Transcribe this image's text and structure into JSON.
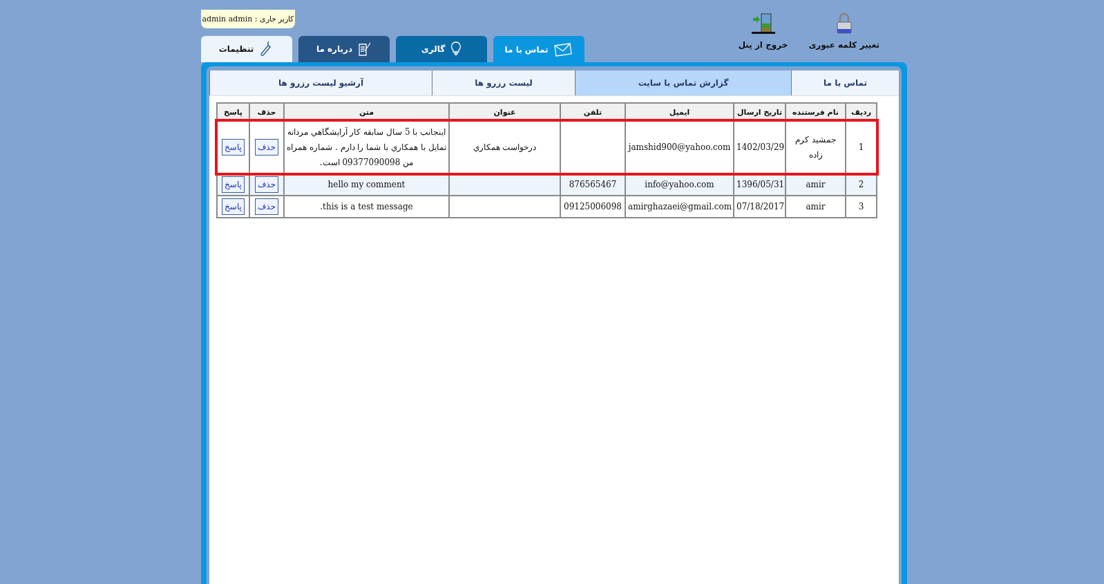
{
  "current_user": {
    "label": "کاربر جاری :",
    "name": "admin admin"
  },
  "main_tabs": [
    {
      "label": "تماس با ما",
      "selected": true,
      "color": "#0b97e0"
    },
    {
      "label": "گالری",
      "selected": false,
      "color": "#0a6aa6"
    },
    {
      "label": "درباره ما",
      "selected": false,
      "color": "#265587"
    },
    {
      "label": "تنظیمات",
      "selected": false,
      "color": "#eef4fc"
    }
  ],
  "toolbar": [
    {
      "label": "تغییر کلمه عبوری"
    },
    {
      "label": "خروج از پنل"
    }
  ],
  "sub_tabs": [
    {
      "label": "تماس با ما",
      "selected": false
    },
    {
      "label": "گزارش تماس با سایت",
      "selected": true
    },
    {
      "label": "لیست رزرو ها",
      "selected": false
    },
    {
      "label": "آرشیو لیست رزرو ها",
      "selected": false
    }
  ],
  "table": {
    "columns": [
      "ردیف",
      "نام فرستنده",
      "تاریخ ارسال",
      "ایمیل",
      "تلفن",
      "عنوان",
      "متن",
      "حذف",
      "پاسخ"
    ],
    "rows": [
      {
        "cells": [
          "1",
          "جمشید کرم زاده",
          "1402/03/29",
          "jamshid900@yahoo.com",
          "",
          "درخواست همکاري",
          "اینجانب با 5 سال سابقه کار آرايشگاهي مردانه تمایل با همکاري با شما را دارم . شماره همراه من 09377090098 است."
        ],
        "delete": "حذف",
        "reply": "پاسخ",
        "highlighted": true,
        "shaded": false
      },
      {
        "cells": [
          "2",
          "amir",
          "1396/05/31",
          "info@yahoo.com",
          "876565467",
          "",
          "hello my comment"
        ],
        "delete": "حذف",
        "reply": "پاسخ",
        "highlighted": false,
        "shaded": true
      },
      {
        "cells": [
          "3",
          "amir",
          "07/18/2017",
          "amirghazaei@gmail.com",
          "09125006098",
          "",
          ".this is a test message"
        ],
        "delete": "حذف",
        "reply": "پاسخ",
        "highlighted": false,
        "shaded": false
      }
    ]
  }
}
